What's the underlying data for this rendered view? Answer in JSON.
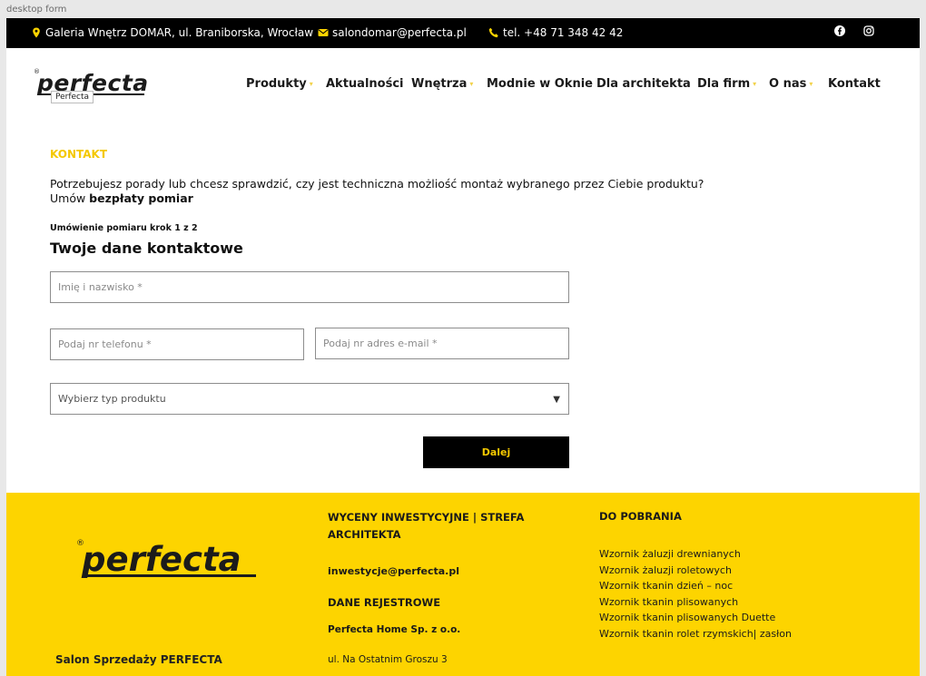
{
  "frame_label": "desktop form",
  "topbar": {
    "address": "Galeria Wnętrz DOMAR, ul. Braniborska, Wrocław",
    "email": "salondomar@perfecta.pl",
    "phone": "tel. +48 71 348 42 42",
    "social": [
      "facebook-icon",
      "instagram-icon"
    ],
    "icon_color": "#fdd400"
  },
  "header": {
    "logo_text": "perfecta",
    "logo_tooltip": "Perfecta",
    "nav": [
      {
        "label": "Produkty",
        "has_dropdown": true
      },
      {
        "label": "Aktualności",
        "has_dropdown": false
      },
      {
        "label": "Wnętrza",
        "has_dropdown": true
      },
      {
        "label": "Modnie w Oknie",
        "has_dropdown": false
      },
      {
        "label": "Dla architekta",
        "has_dropdown": false
      },
      {
        "label": "Dla firm",
        "has_dropdown": true
      },
      {
        "label": "O nas",
        "has_dropdown": true
      },
      {
        "label": "Kontakt",
        "has_dropdown": false
      }
    ]
  },
  "content": {
    "section_label": "KONTAKT",
    "intro_line1": "Potrzebujesz porady lub chcesz sprawdzić, czy jest techniczna możliość montaż wybranego przez Ciebie produktu?",
    "intro_line2_prefix": "Umów ",
    "intro_line2_bold": "bezpłaty pomiar",
    "step_text": "Umówienie pomiaru krok 1 z 2",
    "form_title": "Twoje dane kontaktowe",
    "fields": {
      "name_placeholder": "Imię i nazwisko *",
      "phone_placeholder": "Podaj nr telefonu *",
      "email_placeholder": "Podaj nr adres e-mail *",
      "product_select": "Wybierz typ produktu"
    },
    "submit_label": "Dalej"
  },
  "footer": {
    "logo_text": "perfecta",
    "salon_title": "Salon Sprzedaży PERFECTA",
    "col1_heading": "WYCENY INWESTYCYJNE | STREFA ARCHITEKTA",
    "col1_email": "inwestycje@perfecta.pl",
    "col1_heading2": "DANE REJESTROWE",
    "company": "Perfecta Home Sp. z o.o.",
    "address": "ul. Na Ostatnim Groszu 3",
    "col3_heading": "DO POBRANIA",
    "downloads": [
      "Wzornik żaluzji drewnianych",
      "Wzornik żaluzji roletowych",
      "Wzornik tkanin dzień – noc",
      "Wzornik tkanin plisowanych",
      "Wzornik tkanin plisowanych Duette",
      "Wzornik tkanin rolet rzymskich| zasłon"
    ],
    "background": "#fdd400"
  }
}
